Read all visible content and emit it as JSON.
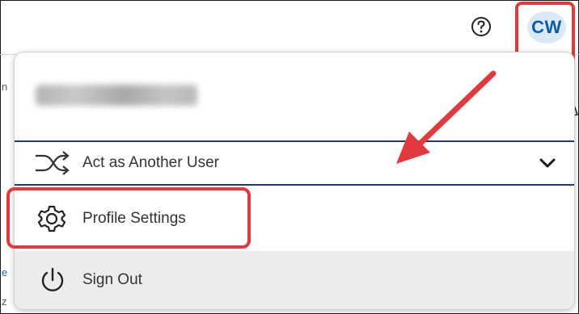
{
  "header": {
    "help_icon": "help-circle-icon",
    "avatar_initials": "CW"
  },
  "menu": {
    "user_name": "",
    "act_as_user": {
      "label": "Act as Another User",
      "icon": "shuffle-icon",
      "chevron": "chevron-down-icon"
    },
    "profile_settings": {
      "label": "Profile Settings",
      "icon": "gear-icon"
    },
    "sign_out": {
      "label": "Sign Out",
      "icon": "power-icon"
    }
  },
  "colors": {
    "accent_blue": "#0a5cab",
    "avatar_bg": "#dbe9f7",
    "highlight_red": "#e0393e",
    "selected_border": "#1f3a6e"
  }
}
